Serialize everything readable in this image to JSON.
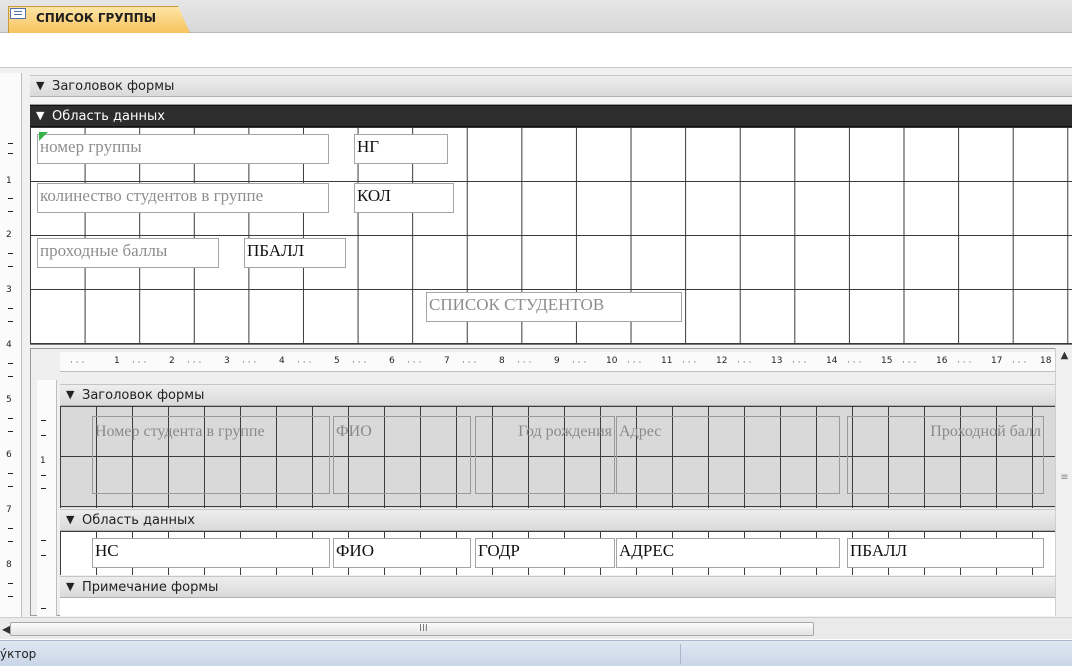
{
  "tab": {
    "label": "СПИСОК ГРУППЫ",
    "icon": "form-icon"
  },
  "main_form": {
    "sections": {
      "header": "Заголовок формы",
      "detail": "Область данных"
    },
    "vruler_marks": [
      "1",
      "2",
      "3",
      "4",
      "5",
      "6",
      "7",
      "8"
    ],
    "controls": {
      "group_number_label": "номер группы",
      "group_number_field": "НГ",
      "students_count_label": "колинество студентов в группе",
      "students_count_field": "КОЛ",
      "pass_score_label": "проходные баллы",
      "pass_score_field": "ПБАЛЛ",
      "students_list_label": "СПИСОК СТУДЕНТОВ"
    }
  },
  "subform": {
    "hruler_marks": [
      "1",
      "2",
      "3",
      "4",
      "5",
      "6",
      "7",
      "8",
      "9",
      "10",
      "11",
      "12",
      "13",
      "14",
      "15",
      "16",
      "17",
      "18"
    ],
    "vruler_marks": [
      "1"
    ],
    "sections": {
      "header": "Заголовок формы",
      "detail": "Область данных",
      "footer": "Примечание формы"
    },
    "header_labels": {
      "student_number": "Номер студента в группе",
      "name": "ФИО",
      "birth_year": "Год рождения",
      "address": "Адрес",
      "pass_score": "Проходной балл"
    },
    "fields": {
      "student_number": "НС",
      "name": "ФИО",
      "birth_year": "ГОДР",
      "address": "АДРЕС",
      "pass_score": "ПБАЛЛ"
    }
  },
  "scrollbar": {
    "grip": "III"
  },
  "status": {
    "text": "ýктор"
  },
  "colors": {
    "tab_accent": "#f8c35c",
    "band_dark": "#2d2d2d",
    "status_bg": "#c9d6e8"
  }
}
